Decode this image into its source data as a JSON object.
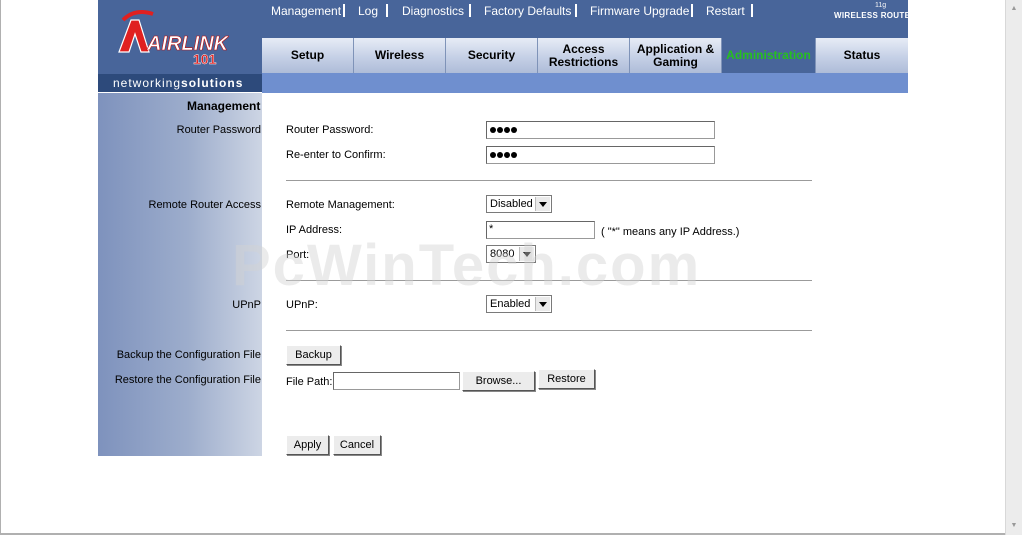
{
  "brand": {
    "logo_text": "AIRLINK",
    "logo_number": "101",
    "tagline_prefix": "networking",
    "tagline_suffix": "solutions",
    "product_small": "11g",
    "product_name": "WIRELESS ROUTER"
  },
  "tabs": [
    {
      "label": "Setup",
      "active": false
    },
    {
      "label": "Wireless",
      "active": false
    },
    {
      "label": "Security",
      "active": false
    },
    {
      "label": "Access\nRestrictions",
      "active": false
    },
    {
      "label": "Application &\nGaming",
      "active": false
    },
    {
      "label": "Administration",
      "active": true
    },
    {
      "label": "Status",
      "active": false
    }
  ],
  "subnav": [
    "Management",
    "Log",
    "Diagnostics",
    "Factory Defaults",
    "Firmware Upgrade",
    "Restart"
  ],
  "section_title": "Management",
  "sections": {
    "router_password": "Router Password",
    "remote_access": "Remote Router Access",
    "upnp": "UPnP",
    "backup": "Backup the Configuration File",
    "restore": "Restore the Configuration File"
  },
  "fields": {
    "router_password_label": "Router Password:",
    "confirm_label": "Re-enter to Confirm:",
    "password_dot_count": 4,
    "confirm_dot_count": 4,
    "remote_mgmt_label": "Remote Management:",
    "remote_mgmt_value": "Disabled",
    "ip_label": "IP Address:",
    "ip_value": "*",
    "ip_hint": "( \"*\" means any IP Address.)",
    "port_label": "Port:",
    "port_value": "8080",
    "upnp_label": "UPnP:",
    "upnp_value": "Enabled",
    "file_path_label": "File Path:",
    "file_path_value": ""
  },
  "buttons": {
    "backup": "Backup",
    "browse": "Browse...",
    "restore": "Restore",
    "apply": "Apply",
    "cancel": "Cancel"
  },
  "watermark": "PcWinTech.com",
  "colors": {
    "header_blue": "#48659a",
    "subnav_blue": "#6f8fcf",
    "active_tab_text": "#26c01f"
  }
}
